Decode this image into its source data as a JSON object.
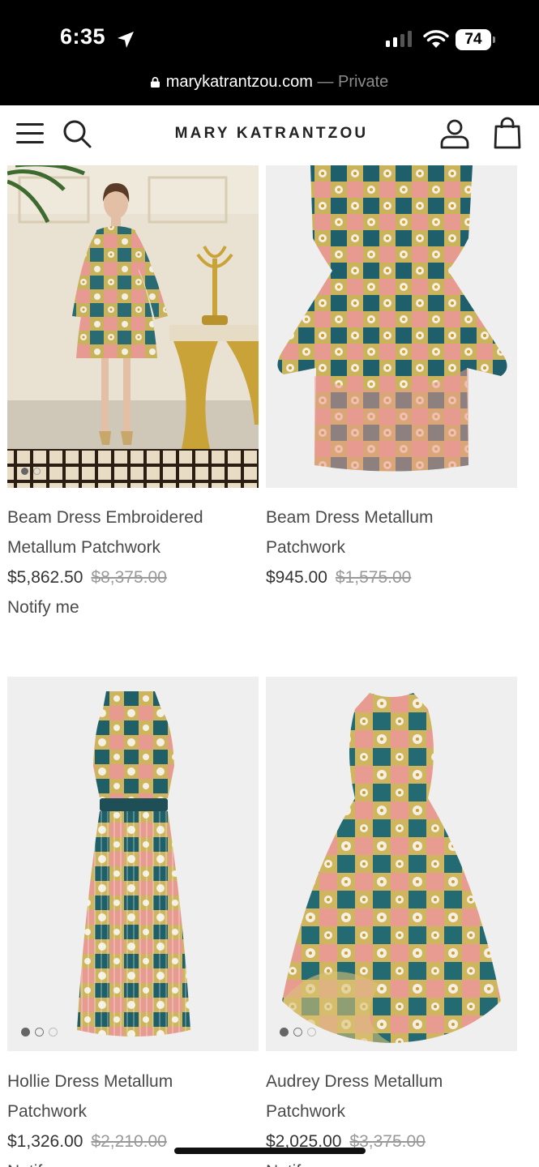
{
  "status_bar": {
    "time": "6:35",
    "battery": "74",
    "url": "marykatrantzou.com",
    "url_suffix": "— Private"
  },
  "header": {
    "brand": "MARY KATRANTZOU",
    "icons": [
      "menu-icon",
      "search-icon",
      "account-icon",
      "bag-icon"
    ]
  },
  "products": [
    {
      "name_line1": "Beam Dress Embroidered",
      "name_line2": "Metallum Patchwork",
      "price": "$5,862.50",
      "original_price": "$8,375.00",
      "action": "Notify me"
    },
    {
      "name_line1": "Beam Dress Metallum",
      "name_line2": "Patchwork",
      "price": "$945.00",
      "original_price": "$1,575.00"
    },
    {
      "name_line1": "Hollie Dress Metallum",
      "name_line2": "Patchwork",
      "price": "$1,326.00",
      "original_price": "$2,210.00",
      "action": "Notify me"
    },
    {
      "name_line1": "Audrey Dress Metallum",
      "name_line2": "Patchwork",
      "price": "$2,025.00",
      "original_price": "$3,375.00",
      "action": "Notify me"
    }
  ],
  "colors": {
    "status_bg": "#000000",
    "text": "#4a4a4a",
    "strike": "#999999",
    "image_bg": "#efefef"
  }
}
